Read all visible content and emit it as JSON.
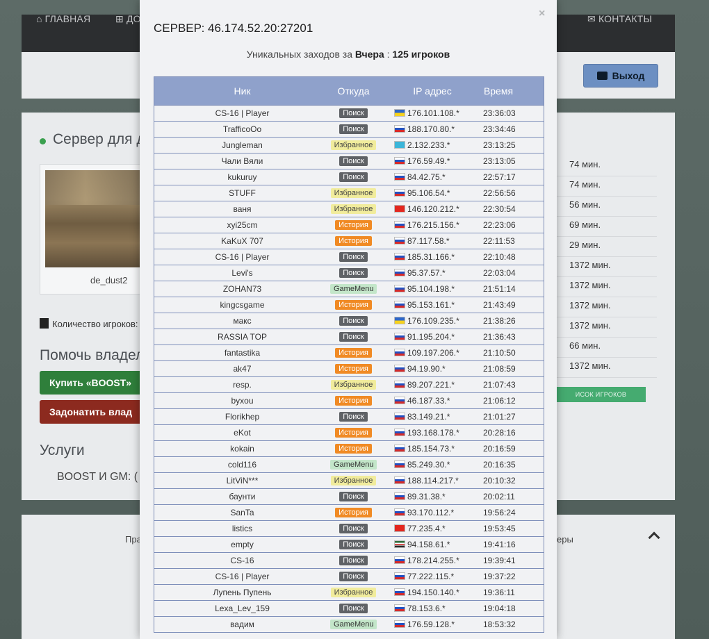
{
  "page": {
    "nav": [
      {
        "icon": "home-icon",
        "label": "ГЛАВНАЯ"
      },
      {
        "icon": "plus-square-icon",
        "label": "ДО"
      },
      {
        "icon": "envelope-icon",
        "label": "КОНТАКТЫ"
      }
    ],
    "logout_label": "Выход",
    "server_title": "Сервер для д",
    "map_name": "de_dust2",
    "players_label": "Количество игроков:",
    "help_title": "Помочь владел",
    "boost_btn": "Купить «BOOST»",
    "donate_btn": "Задонатить влад",
    "services_title": "Услуги",
    "services_line": "BOOST И GM:   (",
    "right_col_values": [
      "74 мин.",
      "74 мин.",
      "56 мин.",
      "69 мин.",
      "29 мин.",
      "1372 мин.",
      "1372 мин.",
      "1372 мин.",
      "1372 мин.",
      "66 мин.",
      "1372 мин."
    ],
    "players_list_btn": "ИСОК ИГРОКОВ",
    "footer_left": "Пра",
    "footer_right": "еры"
  },
  "modal": {
    "close_symbol": "×",
    "title": "СЕРВЕР: 46.174.52.20:27201",
    "subtitle_prefix": "Уникальных заходов за ",
    "subtitle_day": "Вчера",
    "subtitle_sep": " : ",
    "subtitle_count": "125 игроков",
    "columns": [
      "Ник",
      "Откуда",
      "IP адрес",
      "Время"
    ]
  },
  "source_colors": {
    "Поиск": {
      "bg": "#5f6266",
      "fg": "#ffffff"
    },
    "Избранное": {
      "bg": "#f1ec9c",
      "fg": "#444444"
    },
    "История": {
      "bg": "#f08a24",
      "fg": "#ffffff"
    },
    "GameMenu": {
      "bg": "#c3e6c9",
      "fg": "#333333"
    }
  },
  "rows": [
    {
      "nick": "CS-16 | Player",
      "source": "Поиск",
      "flag": "ua",
      "ip": "176.101.108.*",
      "time": "23:36:03"
    },
    {
      "nick": "TrafficoOo",
      "source": "Поиск",
      "flag": "ru",
      "ip": "188.170.80.*",
      "time": "23:34:46"
    },
    {
      "nick": "Jungleman",
      "source": "Избранное",
      "flag": "kz",
      "ip": "2.132.233.*",
      "time": "23:13:25"
    },
    {
      "nick": "Чали Вяли",
      "source": "Поиск",
      "flag": "ru",
      "ip": "176.59.49.*",
      "time": "23:13:05"
    },
    {
      "nick": "kukuruy",
      "source": "Поиск",
      "flag": "ru",
      "ip": "84.42.75.*",
      "time": "22:57:17"
    },
    {
      "nick": "STUFF",
      "source": "Избранное",
      "flag": "ru",
      "ip": "95.106.54.*",
      "time": "22:56:56"
    },
    {
      "nick": "ваня",
      "source": "Избранное",
      "flag": "kg",
      "ip": "146.120.212.*",
      "time": "22:30:54"
    },
    {
      "nick": "xyi25cm",
      "source": "История",
      "flag": "ru",
      "ip": "176.215.156.*",
      "time": "22:23:06"
    },
    {
      "nick": "KaKuX 707",
      "source": "История",
      "flag": "ru",
      "ip": "87.117.58.*",
      "time": "22:11:53"
    },
    {
      "nick": "CS-16 | Player",
      "source": "Поиск",
      "flag": "ru",
      "ip": "185.31.166.*",
      "time": "22:10:48"
    },
    {
      "nick": "Levi's",
      "source": "Поиск",
      "flag": "ru",
      "ip": "95.37.57.*",
      "time": "22:03:04"
    },
    {
      "nick": "ZOHAN73",
      "source": "GameMenu",
      "flag": "ru",
      "ip": "95.104.198.*",
      "time": "21:51:14"
    },
    {
      "nick": "kingcsgame",
      "source": "История",
      "flag": "ru",
      "ip": "95.153.161.*",
      "time": "21:43:49"
    },
    {
      "nick": "макс",
      "source": "Поиск",
      "flag": "ua",
      "ip": "176.109.235.*",
      "time": "21:38:26"
    },
    {
      "nick": "RASSIA TOP",
      "source": "Поиск",
      "flag": "ru",
      "ip": "91.195.204.*",
      "time": "21:36:43"
    },
    {
      "nick": "fantastika",
      "source": "История",
      "flag": "ru",
      "ip": "109.197.206.*",
      "time": "21:10:50"
    },
    {
      "nick": "ak47",
      "source": "История",
      "flag": "ru",
      "ip": "94.19.90.*",
      "time": "21:08:59"
    },
    {
      "nick": "resp.",
      "source": "Избранное",
      "flag": "ru",
      "ip": "89.207.221.*",
      "time": "21:07:43"
    },
    {
      "nick": "byxou",
      "source": "История",
      "flag": "ru",
      "ip": "46.187.33.*",
      "time": "21:06:12"
    },
    {
      "nick": "Florikhep",
      "source": "Поиск",
      "flag": "ru",
      "ip": "83.149.21.*",
      "time": "21:01:27"
    },
    {
      "nick": "eKot",
      "source": "История",
      "flag": "ru",
      "ip": "193.168.178.*",
      "time": "20:28:16"
    },
    {
      "nick": "kokain",
      "source": "История",
      "flag": "ru",
      "ip": "185.154.73.*",
      "time": "20:16:59"
    },
    {
      "nick": "cold116",
      "source": "GameMenu",
      "flag": "ru",
      "ip": "85.249.30.*",
      "time": "20:16:35"
    },
    {
      "nick": "LitViN***",
      "source": "Избранное",
      "flag": "ru",
      "ip": "188.114.217.*",
      "time": "20:10:32"
    },
    {
      "nick": "баунти",
      "source": "Поиск",
      "flag": "ru",
      "ip": "89.31.38.*",
      "time": "20:02:11"
    },
    {
      "nick": "SanTa",
      "source": "История",
      "flag": "ru",
      "ip": "93.170.112.*",
      "time": "19:56:24"
    },
    {
      "nick": "listics",
      "source": "Поиск",
      "flag": "kg",
      "ip": "77.235.4.*",
      "time": "19:53:45"
    },
    {
      "nick": "empty",
      "source": "Поиск",
      "flag": "tm",
      "ip": "94.158.61.*",
      "time": "19:41:16"
    },
    {
      "nick": "CS-16",
      "source": "Поиск",
      "flag": "ru",
      "ip": "178.214.255.*",
      "time": "19:39:41"
    },
    {
      "nick": "CS-16 | Player",
      "source": "Поиск",
      "flag": "ru",
      "ip": "77.222.115.*",
      "time": "19:37:22"
    },
    {
      "nick": "Лупень Пупень",
      "source": "Избранное",
      "flag": "ru",
      "ip": "194.150.140.*",
      "time": "19:36:11"
    },
    {
      "nick": "Lexa_Lev_159",
      "source": "Поиск",
      "flag": "ru",
      "ip": "78.153.6.*",
      "time": "19:04:18"
    },
    {
      "nick": "вадим",
      "source": "GameMenu",
      "flag": "ru",
      "ip": "176.59.128.*",
      "time": "18:53:32"
    }
  ]
}
